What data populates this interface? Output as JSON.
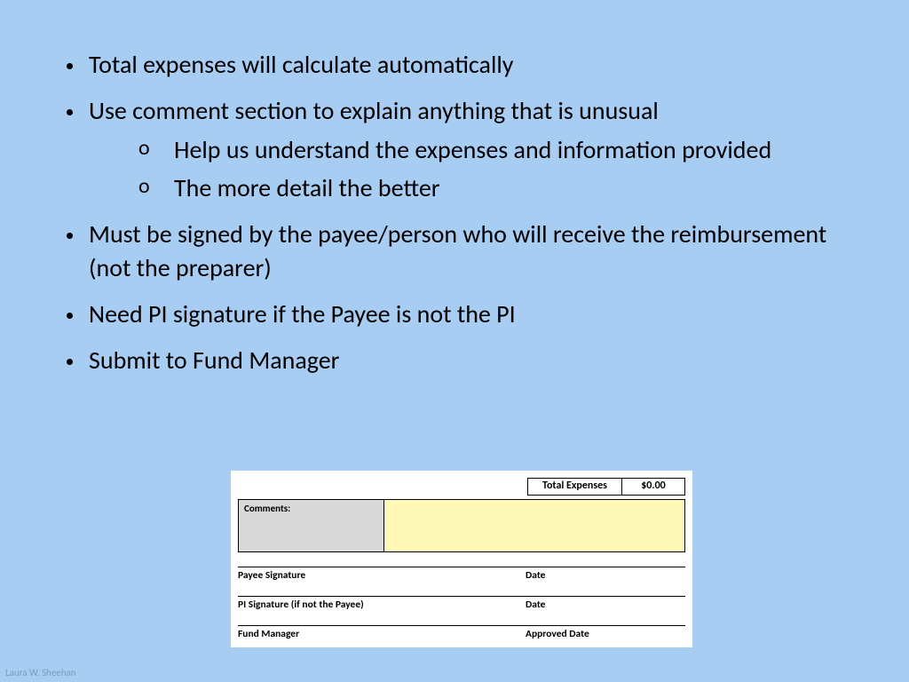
{
  "bullets": {
    "b1": "Total expenses will calculate automatically",
    "b2": "Use comment section to explain anything that is unusual",
    "b2_sub": {
      "s1": "Help us understand the expenses and information provided",
      "s2": "The more detail the better"
    },
    "b3": "Must be signed by the payee/person who will receive the reimbursement (not the preparer)",
    "b4": "Need PI signature if the Payee is not the PI",
    "b5": "Submit to Fund Manager"
  },
  "form": {
    "total_label": "Total Expenses",
    "total_value": "$0.00",
    "comments_label": "Comments:",
    "sig1_left": "Payee Signature",
    "sig1_right": "Date",
    "sig2_left": "PI Signature (if not the Payee)",
    "sig2_right": "Date",
    "sig3_left": "Fund Manager",
    "sig3_right": "Approved Date"
  },
  "footer": "Laura W. Sheehan"
}
